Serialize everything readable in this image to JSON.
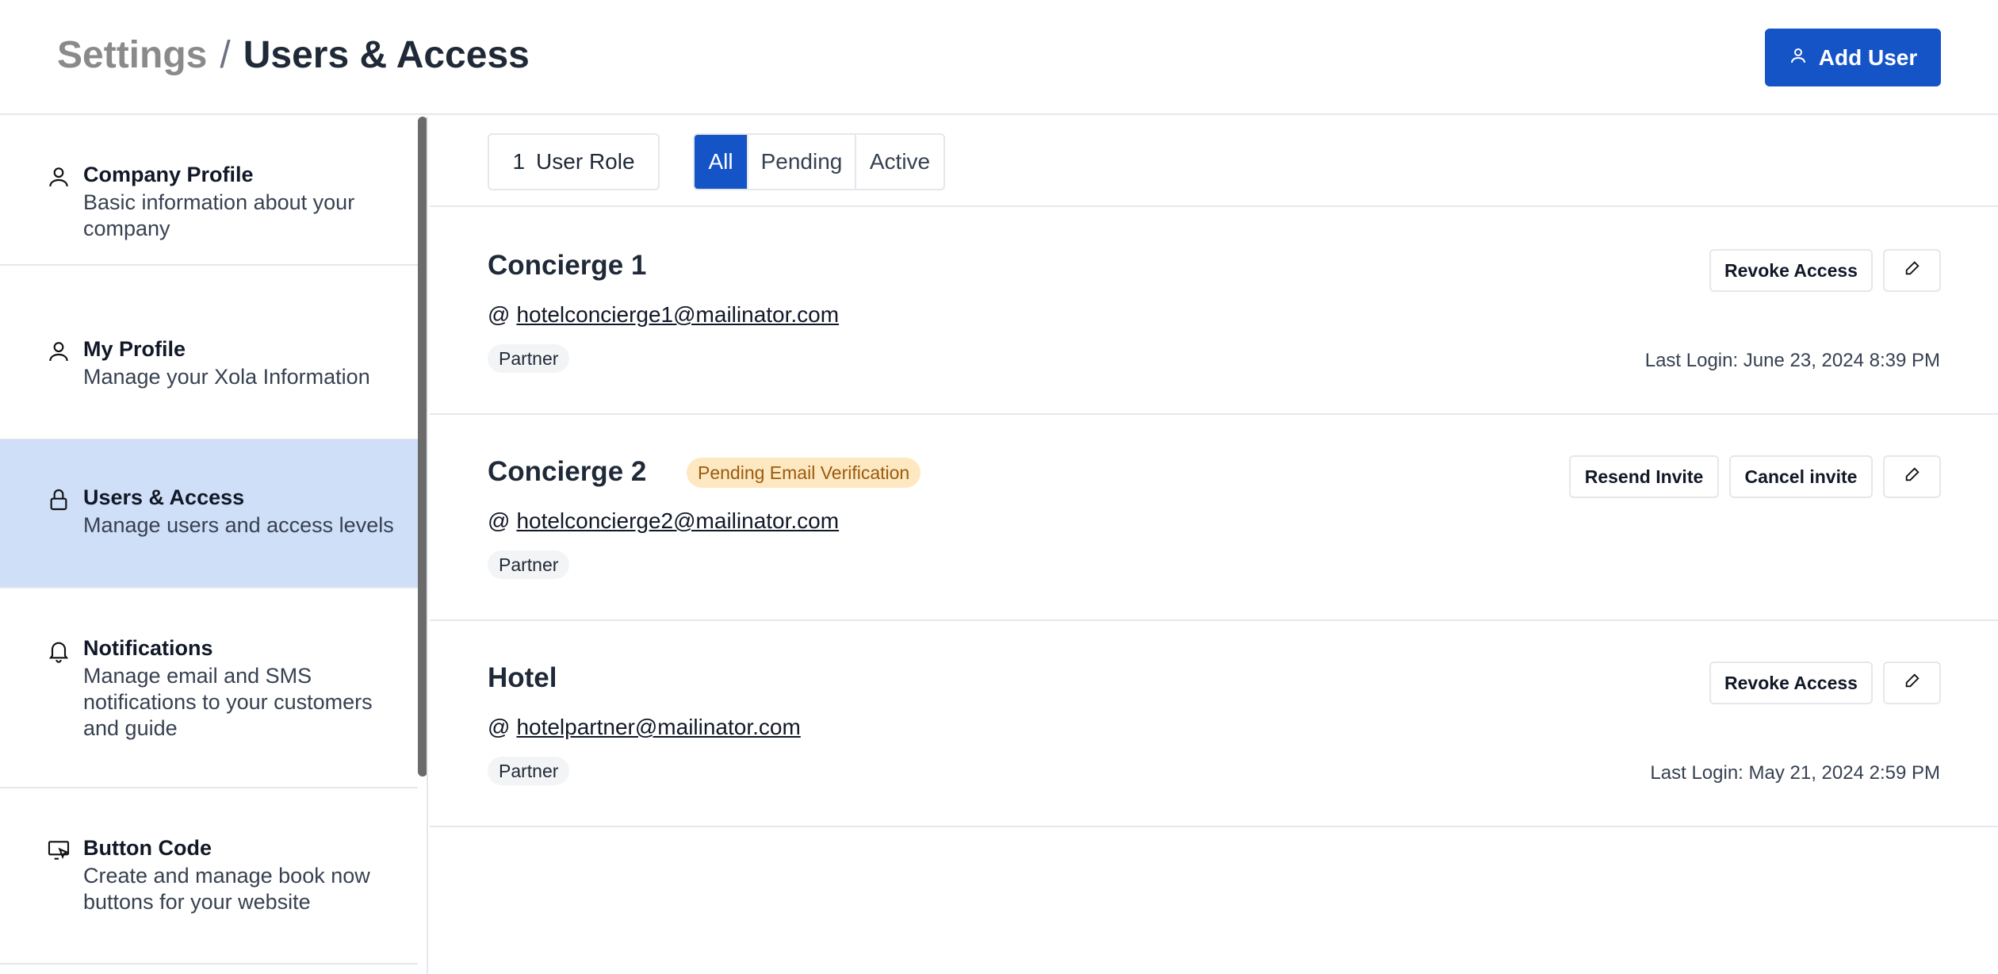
{
  "header": {
    "breadcrumb_root": "Settings",
    "breadcrumb_sep": "/",
    "breadcrumb_current": "Users & Access",
    "add_user_label": "Add User",
    "add_user_icon": "user-icon"
  },
  "sidebar": {
    "items": [
      {
        "title": "Company Profile",
        "desc": "Basic information about your company",
        "icon": "user-icon",
        "active": false
      },
      {
        "title": "My Profile",
        "desc": "Manage your Xola Information",
        "icon": "user-icon",
        "active": false
      },
      {
        "title": "Users & Access",
        "desc": "Manage users and access levels",
        "icon": "lock-icon",
        "active": true
      },
      {
        "title": "Notifications",
        "desc": "Manage email and SMS notifications to your customers and guide",
        "icon": "bell-icon",
        "active": false
      },
      {
        "title": "Button Code",
        "desc": "Create and manage book now buttons for your website",
        "icon": "monitor-pointer-icon",
        "active": false
      }
    ]
  },
  "filters": {
    "role_count": "1",
    "role_label": "User Role",
    "tabs": [
      {
        "label": "All",
        "active": true
      },
      {
        "label": "Pending",
        "active": false
      },
      {
        "label": "Active",
        "active": false
      }
    ]
  },
  "users": [
    {
      "name": "Concierge 1",
      "email": "hotelconcierge1@mailinator.com",
      "role": "Partner",
      "status_badge": "",
      "last_login": "Last Login: June 23, 2024 8:39 PM",
      "actions": [
        "Revoke Access"
      ]
    },
    {
      "name": "Concierge 2",
      "email": "hotelconcierge2@mailinator.com",
      "role": "Partner",
      "status_badge": "Pending Email Verification",
      "last_login": "",
      "actions": [
        "Resend Invite",
        "Cancel invite"
      ]
    },
    {
      "name": "Hotel",
      "email": "hotelpartner@mailinator.com",
      "role": "Partner",
      "status_badge": "",
      "last_login": "Last Login: May 21, 2024 2:59 PM",
      "actions": [
        "Revoke Access"
      ]
    }
  ],
  "at_symbol": "@",
  "colors": {
    "primary": "#1554c7",
    "sidebar_active": "#cfdff8",
    "pending_badge_bg": "#fde8c2",
    "pending_badge_text": "#9a5b0c",
    "border": "#e5e7eb"
  }
}
